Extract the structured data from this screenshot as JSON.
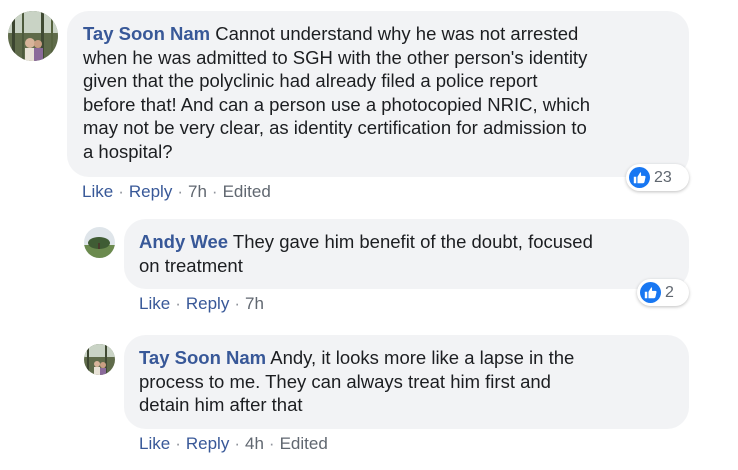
{
  "comments": [
    {
      "author": "Tay Soon Nam",
      "lines": [
        "Cannot understand why he was not arrested",
        "when he was admitted to SGH with the other person's identity",
        "given that the polyclinic had already filed a police report",
        "before that! And can a person use a photocopied NRIC, which",
        "may not be very clear, as identity certification for admission to",
        "a hospital?"
      ],
      "like_label": "Like",
      "reply_label": "Reply",
      "time": "7h",
      "edited": "Edited",
      "reaction_count": "23"
    },
    {
      "author": "Andy Wee",
      "lines": [
        "They gave him benefit of the doubt, focused",
        "on treatment"
      ],
      "like_label": "Like",
      "reply_label": "Reply",
      "time": "7h",
      "reaction_count": "2"
    },
    {
      "author": "Tay Soon Nam",
      "lines": [
        "Andy, it looks more like a lapse in the",
        "process to me. They can always treat him first and",
        "detain him after that"
      ],
      "like_label": "Like",
      "reply_label": "Reply",
      "time": "4h",
      "edited": "Edited"
    }
  ],
  "separator": "·",
  "icons": {
    "reaction": "thumbs-up-icon",
    "like_color": "#1877f2",
    "author_color": "#385898"
  }
}
